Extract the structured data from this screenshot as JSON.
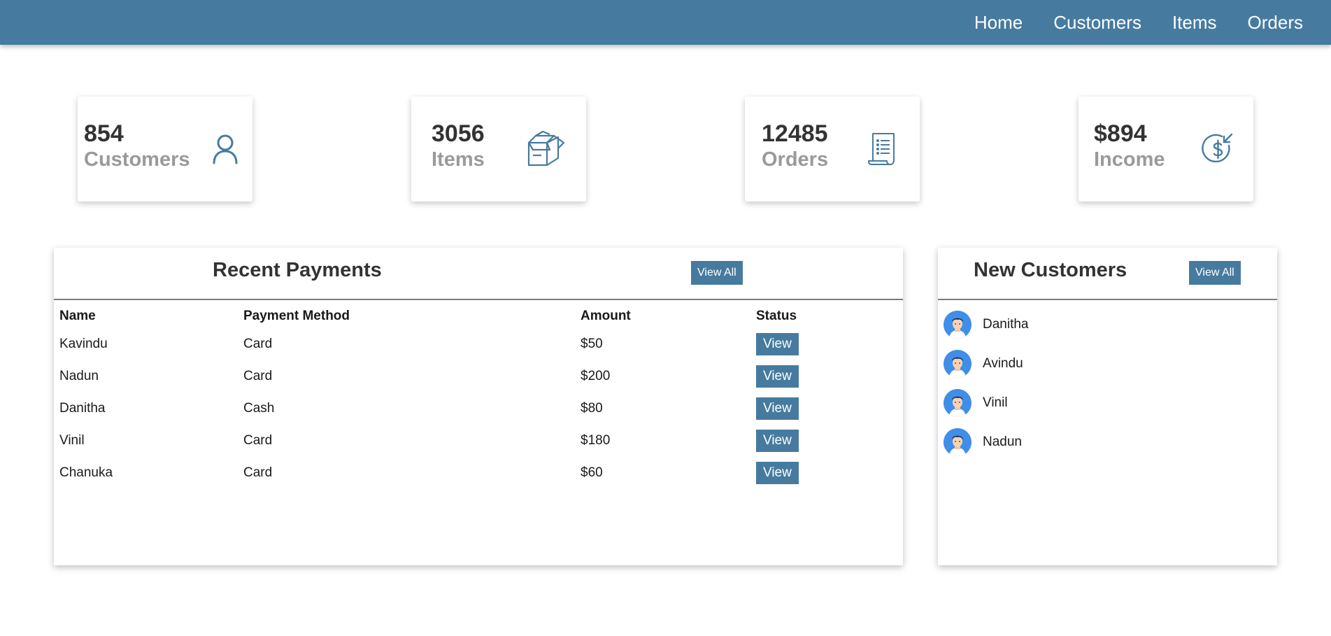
{
  "nav": {
    "links": [
      "Home",
      "Customers",
      "Items",
      "Orders"
    ]
  },
  "stats": [
    {
      "value": "854",
      "label": "Customers",
      "icon": "user-icon"
    },
    {
      "value": "3056",
      "label": "Items",
      "icon": "box-icon"
    },
    {
      "value": "12485",
      "label": "Orders",
      "icon": "receipt-icon"
    },
    {
      "value": "$894",
      "label": "Income",
      "icon": "income-icon"
    }
  ],
  "payments": {
    "title": "Recent Payments",
    "view_all": "View All",
    "headers": [
      "Name",
      "Payment Method",
      "Amount",
      "Status"
    ],
    "rows": [
      {
        "name": "Kavindu",
        "method": "Card",
        "amount": "$50",
        "status": "View"
      },
      {
        "name": "Nadun",
        "method": "Card",
        "amount": "$200",
        "status": "View"
      },
      {
        "name": "Danitha",
        "method": "Cash",
        "amount": "$80",
        "status": "View"
      },
      {
        "name": "Vinil",
        "method": "Card",
        "amount": "$180",
        "status": "View"
      },
      {
        "name": "Chanuka",
        "method": "Card",
        "amount": "$60",
        "status": "View"
      }
    ]
  },
  "customers": {
    "title": "New Customers",
    "view_all": "View All",
    "list": [
      "Danitha",
      "Avindu",
      "Vinil",
      "Nadun"
    ]
  },
  "colors": {
    "accent": "#467b9f",
    "avatar_bg": "#3f8ee8"
  }
}
